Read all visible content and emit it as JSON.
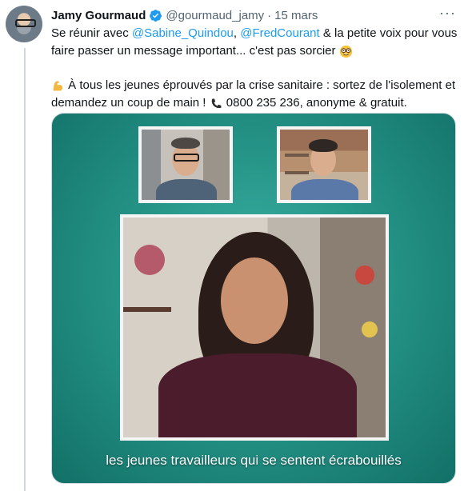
{
  "tweet": {
    "author_name": "Jamy Gourmaud",
    "handle": "@gourmaud_jamy",
    "separator": "·",
    "date": "15 mars",
    "more_label": "···",
    "line1_pre": "Se réunir avec ",
    "mention1": "@Sabine_Quindou",
    "comma": ", ",
    "mention2": "@FredCourant",
    "line1_post": " & la petite voix pour vous faire passer un message important... c'est pas sorcier",
    "line2_pre": " À tous les jeunes éprouvés par la crise sanitaire : sortez de l'isolement et demandez un coup de main !",
    "line2_post": " 0800 235 236, anonyme & gratuit."
  },
  "video": {
    "caption": "les jeunes travailleurs qui se sentent écrabouillés"
  },
  "colors": {
    "link": "#1d9bf0",
    "muted": "#536471",
    "teal_background": "#259487"
  },
  "icons": {
    "verified": "verified-badge-icon",
    "nerd_emoji": "nerd-face-icon",
    "muscle_emoji": "flexed-biceps-icon",
    "phone_emoji": "telephone-receiver-icon",
    "more": "more-options-icon"
  }
}
